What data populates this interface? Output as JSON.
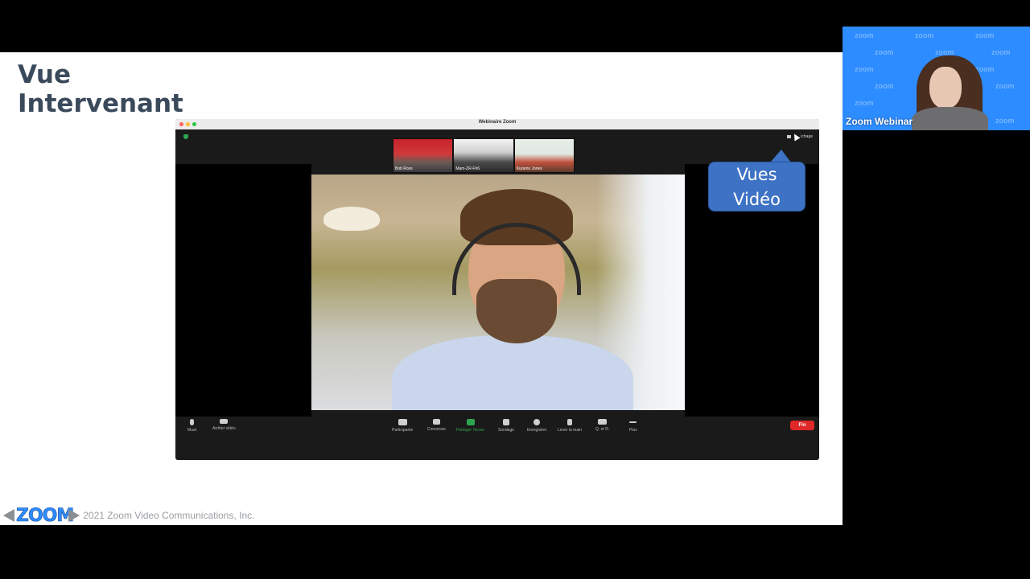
{
  "slide": {
    "title_line1": "Vue",
    "title_line2": "Intervenant",
    "copyright": "2021 Zoom Video Communications, Inc.",
    "logo_text": "ZOOM"
  },
  "zoom_window": {
    "title": "Webinaire Zoom",
    "view_button_label": "ichage",
    "gallery": [
      {
        "name": "Bob Ross"
      },
      {
        "name": "Mam-ZR-Flr6"
      },
      {
        "name": "Kuramo Jones"
      }
    ],
    "toolbar": {
      "mute": "Muet",
      "stop_video": "Arrêter vidéo",
      "participants": "Participants",
      "chat": "Converser",
      "share_screen": "Partager l'écran",
      "poll": "Sondage",
      "record": "Enregistrer",
      "raise_hand": "Lever la main",
      "qa": "Q. et R.",
      "more": "Plus",
      "end": "Fin"
    }
  },
  "callout": {
    "line1": "Vues",
    "line2": "Vidéo"
  },
  "presenter_tile": {
    "name": "Zoom Webinar",
    "pattern_word": "zoom"
  },
  "colors": {
    "zoom_blue": "#2d8cff",
    "callout_blue": "#3d72c4",
    "end_red": "#e02828",
    "share_green": "#2ea44f"
  }
}
